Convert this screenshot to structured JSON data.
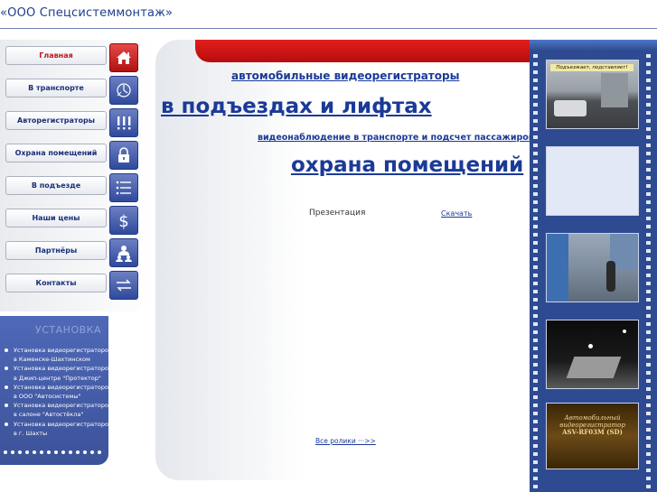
{
  "header": {
    "site_title": "«ООО Спецсистеммонтаж»"
  },
  "nav": [
    {
      "label": "Главная",
      "icon": "home-icon",
      "active": true
    },
    {
      "label": "В транспорте",
      "icon": "bus-icon"
    },
    {
      "label": "Авторегистраторы",
      "icon": "exclamation-icon"
    },
    {
      "label": "Охрана помещений",
      "icon": "lock-icon"
    },
    {
      "label": "В подъезде",
      "icon": "list-icon"
    },
    {
      "label": "Наши цены",
      "icon": "dollar-icon"
    },
    {
      "label": "Партнёры",
      "icon": "people-icon"
    },
    {
      "label": "Контакты",
      "icon": "arrows-icon"
    }
  ],
  "install": {
    "title": "УСТАНОВКА",
    "items": [
      {
        "line1": "Установка видеорегистраторов",
        "line2": "в Каменске-Шахтинском"
      },
      {
        "line1": "Установка видеорегистраторов",
        "line2": "в Джип-центре \"Протектор\""
      },
      {
        "line1": "Установка видеорегистраторов",
        "line2": "в ООО \"Автосистемы\""
      },
      {
        "line1": "Установка видеорегистраторов",
        "line2": "в салоне \"Автостёкла\""
      },
      {
        "line1": "Установка видеорегистраторов",
        "line2": "в г. Шахты"
      }
    ]
  },
  "main": {
    "link_car_recorders": "автомобильные видеорегистраторы",
    "link_entrances": "в подъездах и лифтах",
    "link_transport": "видеонаблюдение в транспорте и подсчет пассажиров",
    "link_security": "охрана помещений",
    "presentation_label": "Презентация",
    "download_link": "Скачать",
    "all_videos_link": "Все ролики ···>>"
  },
  "film": {
    "frame1_caption": "Подъезжает, подставляет!",
    "frame5_line1": "Автомобильный",
    "frame5_line2": "видеорегистратор",
    "frame5_line3": "ASV-RF03M (SD)"
  },
  "colors": {
    "accent_red": "#c0161c",
    "nav_blue": "#2f4a9c",
    "link_blue": "#1b3a97"
  }
}
